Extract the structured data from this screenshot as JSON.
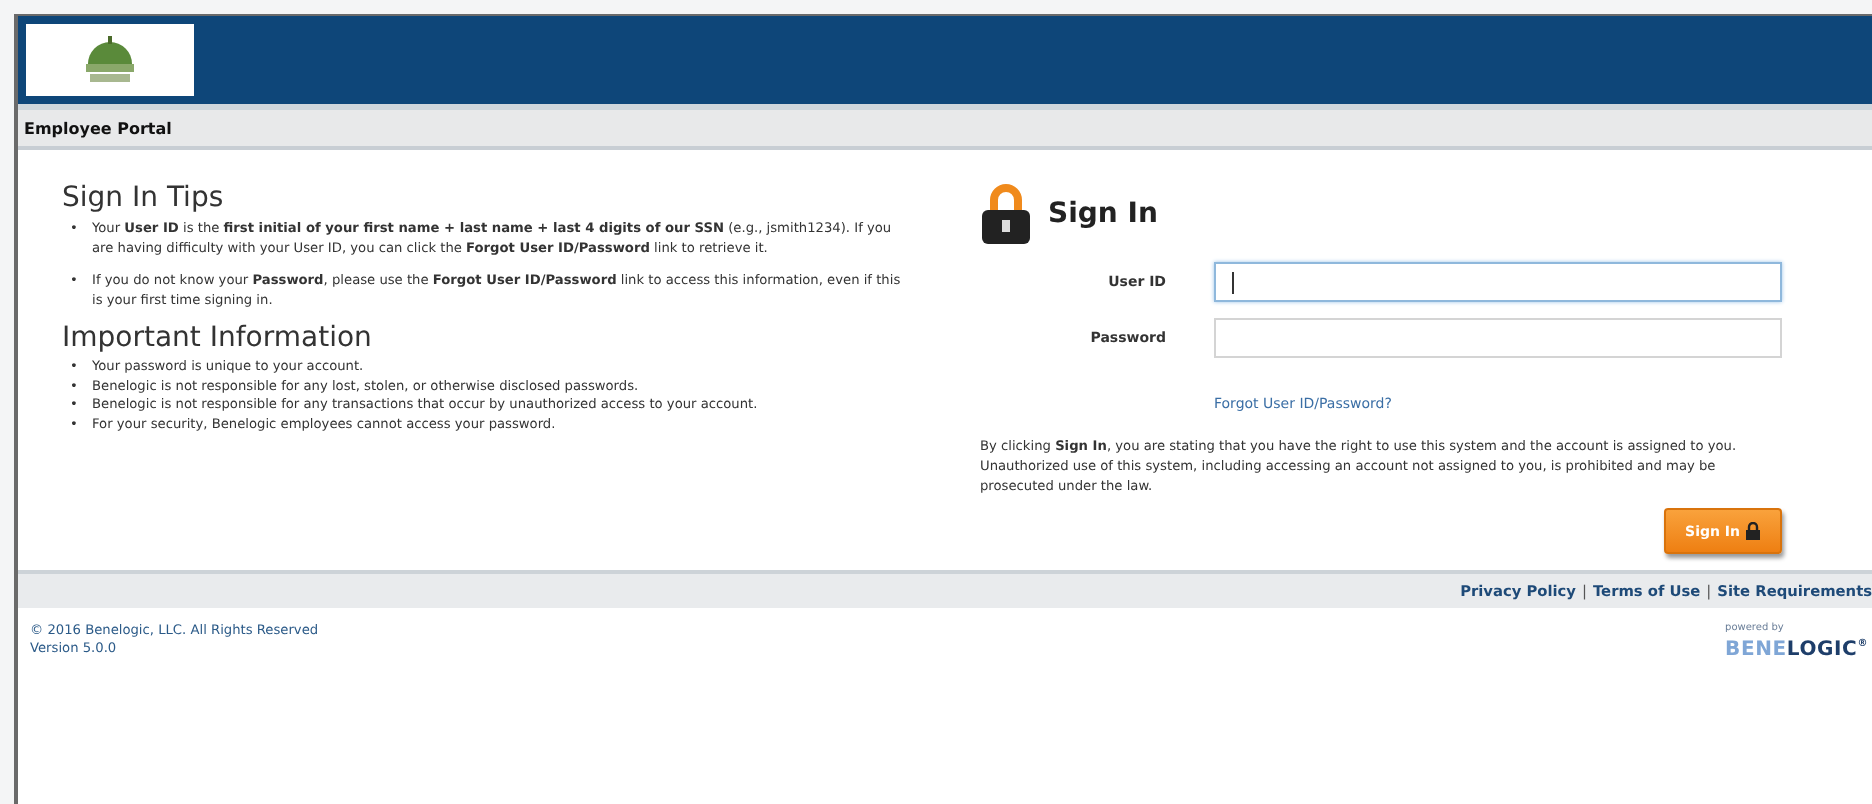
{
  "header": {
    "portal_title": "Employee Portal"
  },
  "bullet": "•",
  "tips": {
    "title": "Sign In Tips",
    "items": [
      "Your **User ID** is the **first initial of your first name + last name + last 4 digits of our SSN** (e.g., jsmith1234). If you are having difficulty with your User ID, you can click the **Forgot User ID/Password** link to retrieve it.",
      "If you do not know your **Password**, please use the **Forgot User ID/Password** link to access this information, even if this is your first time signing in."
    ]
  },
  "info": {
    "title": "Important Information",
    "items": [
      "Your password is unique to your account.",
      "Benelogic is not responsible for any lost, stolen, or otherwise disclosed passwords.",
      "Benelogic is not responsible for any transactions that occur by unauthorized access to your account.",
      "For your security, Benelogic employees cannot access your password."
    ]
  },
  "sign_in": {
    "title": "Sign In",
    "fields": [
      {
        "label": "User ID",
        "focused": true
      },
      {
        "label": "Password",
        "focused": false
      }
    ],
    "forgot_link": "Forgot User ID/Password?",
    "disclaimer": "By clicking **Sign In**, you are stating that you have the right to use this system and the account is assigned to you. Unauthorized use of this system, including accessing an account not assigned to you, is prohibited and may be prosecuted under the law.",
    "button": "Sign In"
  },
  "footer": {
    "links": [
      "Privacy Policy",
      "Terms of Use",
      "Site Requirements"
    ],
    "separator": "|",
    "copyright": "© 2016 Benelogic, LLC. All Rights Reserved",
    "version": "Version 5.0.0",
    "powered_by": "powered by",
    "brand_light": "BENE",
    "brand_dark": "LOGIC",
    "brand_mark": "®"
  }
}
